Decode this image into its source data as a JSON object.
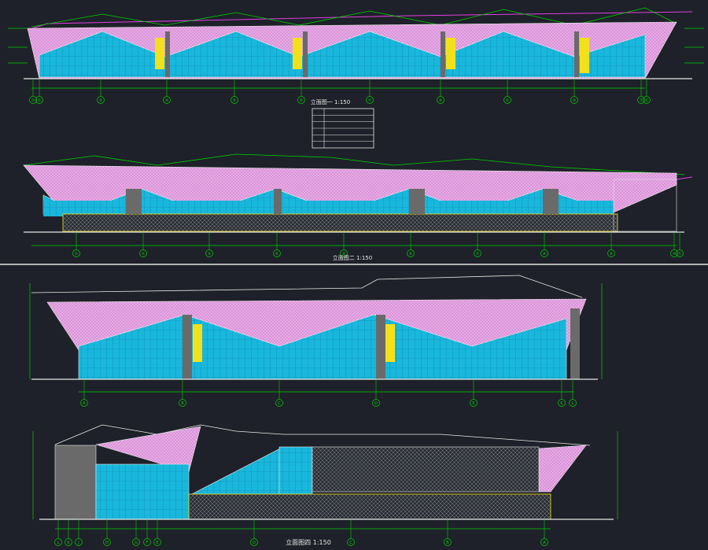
{
  "colors": {
    "background": "#1e2129",
    "line_white": "#e8e8e8",
    "dim_green": "#00d000",
    "glass_cyan": "#19b7dc",
    "roof_pink": "#e8a8e6",
    "accent_magenta": "#e040e0",
    "panel_yellow": "#f2e11a",
    "pillar_gray": "#6a6a6a",
    "grid_blue": "#1a5fd0"
  },
  "drawing": {
    "titles": {
      "elevation_1": "立面图一 1:150",
      "elevation_2": "立面图二 1:150",
      "elevation_4": "立面图四 1:150"
    },
    "legend_rows": 6
  },
  "elevation_1_axes": [
    "①",
    "②",
    "③",
    "④",
    "⑤",
    "⑥",
    "⑦",
    "⑧",
    "⑨",
    "⑩",
    "⑪",
    "⑫"
  ],
  "elevation_2_axes": [
    "①",
    "②",
    "③",
    "④",
    "⑤",
    "⑥",
    "⑦",
    "⑧",
    "⑨",
    "⑩",
    "⑪"
  ],
  "elevation_3_axes": [
    "A",
    "B",
    "C",
    "D",
    "E",
    "K",
    "L"
  ],
  "elevation_4_axes": [
    "L",
    "K",
    "J",
    "H",
    "G",
    "F",
    "E",
    "D",
    "C",
    "B",
    "A"
  ]
}
